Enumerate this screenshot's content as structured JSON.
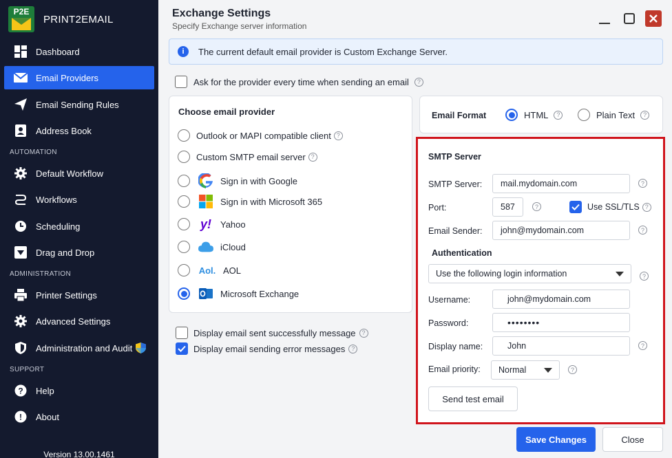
{
  "brand": {
    "logo_text": "P2E",
    "name": "PRINT2EMAIL"
  },
  "nav": {
    "dashboard": "Dashboard",
    "email_providers": "Email Providers",
    "email_sending_rules": "Email Sending Rules",
    "address_book": "Address Book",
    "section_automation": "AUTOMATION",
    "default_workflow": "Default Workflow",
    "workflows": "Workflows",
    "scheduling": "Scheduling",
    "drag_and_drop": "Drag and Drop",
    "section_administration": "ADMINISTRATION",
    "printer_settings": "Printer Settings",
    "advanced_settings": "Advanced Settings",
    "administration_and_audit": "Administration and Audit",
    "section_support": "SUPPORT",
    "help": "Help",
    "about": "About",
    "version": "Version 13.00.1461"
  },
  "header": {
    "title": "Exchange Settings",
    "subtitle": "Specify Exchange server information"
  },
  "banner": {
    "icon": "i",
    "text": "The current default email provider is Custom Exchange Server."
  },
  "ask_provider": {
    "label": "Ask for the provider every time when sending an email",
    "checked": false
  },
  "provider_card": {
    "title": "Choose email provider",
    "options": [
      {
        "label": "Outlook or MAPI compatible client",
        "selected": false
      },
      {
        "label": "Custom SMTP email server",
        "selected": false
      },
      {
        "label": "Sign in with Google",
        "icon": "google-icon",
        "selected": false
      },
      {
        "label": "Sign in with Microsoft 365",
        "icon": "microsoft-icon",
        "selected": false
      },
      {
        "label": "Yahoo",
        "icon": "yahoo-icon",
        "selected": false
      },
      {
        "label": "iCloud",
        "icon": "icloud-icon",
        "selected": false
      },
      {
        "label": "AOL",
        "icon": "aol-icon",
        "selected": false
      },
      {
        "label": "Microsoft Exchange",
        "icon": "outlook-icon",
        "selected": true
      }
    ]
  },
  "display_success": {
    "label": "Display email sent successfully message",
    "checked": false
  },
  "display_error": {
    "label": "Display email sending error messages",
    "checked": true
  },
  "email_format": {
    "label": "Email Format",
    "html": "HTML",
    "plain": "Plain Text",
    "selected": "HTML"
  },
  "smtp": {
    "title": "SMTP Server",
    "server_label": "SMTP Server:",
    "server_value": "mail.mydomain.com",
    "port_label": "Port:",
    "port_value": "587",
    "ssl_label": "Use SSL/TLS",
    "ssl_checked": true,
    "sender_label": "Email Sender:",
    "sender_value": "john@mydomain.com",
    "auth_title": "Authentication",
    "auth_select": "Use the following login information",
    "username_label": "Username:",
    "username_value": "john@mydomain.com",
    "password_label": "Password:",
    "password_value": "••••••••",
    "display_name_label": "Display name:",
    "display_name_value": "John",
    "priority_label": "Email priority:",
    "priority_value": "Normal",
    "test_button": "Send test email"
  },
  "footer": {
    "save": "Save Changes",
    "close": "Close"
  },
  "colors": {
    "sidebar": "#141a2e",
    "accent": "#2563eb",
    "highlight_border": "#d0141c",
    "close_button": "#c0392b"
  }
}
